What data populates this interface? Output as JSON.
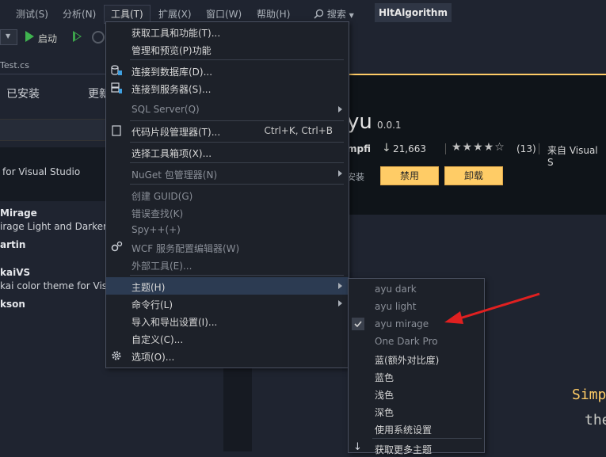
{
  "menubar": {
    "items": [
      "测试(S)",
      "分析(N)",
      "工具(T)",
      "扩展(X)",
      "窗口(W)",
      "帮助(H)"
    ],
    "search_label": "搜索",
    "app_title": "HltAlgorithm"
  },
  "toolbar": {
    "start_label": "启动"
  },
  "file_tab": {
    "name": "Test.cs"
  },
  "left_pane": {
    "tab_installed": "已安装",
    "tab_updates": "更新",
    "card_text": "for Visual Studio",
    "items": [
      {
        "title": "Mirage",
        "subtitle": "irage Light and Darker"
      },
      {
        "title": "artin",
        "subtitle": ""
      },
      {
        "title": "kaiVS",
        "subtitle": "kai color theme for Vis"
      },
      {
        "title": "kson",
        "subtitle": ""
      }
    ]
  },
  "detail": {
    "name": "yu",
    "version": "0.0.1",
    "author": "mpfi",
    "downloads": "21,663",
    "rating": 4,
    "rating_count": "(13)",
    "source": "来自 Visual S",
    "installed_label": "安装",
    "disable_button": "禁用",
    "uninstall_button": "卸载",
    "code_line1": "Simp",
    "code_line2": "the"
  },
  "tools_menu": {
    "items": [
      {
        "label": "获取工具和功能(T)..."
      },
      {
        "label": "管理和预览(P)功能"
      },
      {
        "label": "连接到数据库(D)...",
        "icon": "database-icon"
      },
      {
        "label": "连接到服务器(S)...",
        "icon": "server-icon"
      },
      {
        "label": "SQL Server(Q)",
        "submenu": true,
        "disabled": true
      },
      {
        "label": "代码片段管理器(T)...",
        "shortcut": "Ctrl+K, Ctrl+B",
        "icon": "snippet-icon"
      },
      {
        "label": "选择工具箱项(X)..."
      },
      {
        "label": "NuGet 包管理器(N)",
        "submenu": true
      },
      {
        "label": "创建 GUID(G)"
      },
      {
        "label": "错误查找(K)"
      },
      {
        "label": "Spy++(+)"
      },
      {
        "label": "WCF 服务配置编辑器(W)",
        "icon": "wcf-gear-icon"
      },
      {
        "label": "外部工具(E)..."
      },
      {
        "label": "主题(H)",
        "submenu": true,
        "highlighted": true
      },
      {
        "label": "命令行(L)",
        "submenu": true
      },
      {
        "label": "导入和导出设置(I)..."
      },
      {
        "label": "自定义(C)..."
      },
      {
        "label": "选项(O)...",
        "icon": "settings-gear-icon"
      }
    ]
  },
  "theme_menu": {
    "items": [
      {
        "label": "ayu dark"
      },
      {
        "label": "ayu light"
      },
      {
        "label": "ayu mirage",
        "checked": true
      },
      {
        "label": "One Dark Pro"
      },
      {
        "label": "蓝(额外对比度)"
      },
      {
        "label": "蓝色"
      },
      {
        "label": "浅色"
      },
      {
        "label": "深色"
      },
      {
        "label": "使用系统设置"
      },
      {
        "label": "获取更多主题",
        "icon": "download-icon"
      }
    ]
  },
  "colors": {
    "accent": "#ffcc66",
    "arrow": "#e02020",
    "highlight": "#2c3b52"
  }
}
